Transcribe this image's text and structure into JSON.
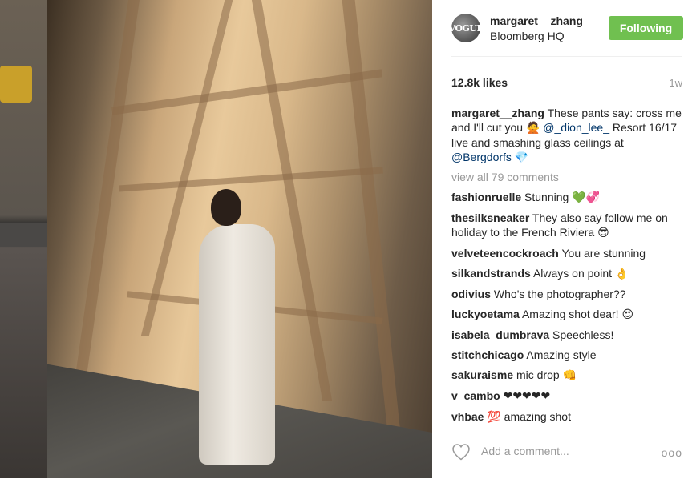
{
  "post": {
    "username": "margaret__zhang",
    "location": "Bloomberg HQ",
    "follow_label": "Following",
    "avatar_text": "VOGUE",
    "likes": "12.8k likes",
    "time": "1w",
    "caption": {
      "user": "margaret__zhang",
      "text_1": " These pants say: cross me and I'll cut you ",
      "emoji_1": "🙅",
      "mention_1": "@_dion_lee_",
      "text_2": " Resort 16/17 live and smashing glass ceilings at ",
      "mention_2": "@Bergdorfs",
      "emoji_2": "💎"
    },
    "view_all": "view all 79 comments",
    "comments": [
      {
        "user": "fashionruelle",
        "text": " Stunning ",
        "emoji": "💚💞"
      },
      {
        "user": "thesilksneaker",
        "text": " They also say follow me on holiday to the French Riviera ",
        "emoji": "😎"
      },
      {
        "user": "velveteencockroach",
        "text": " You are stunning",
        "emoji": ""
      },
      {
        "user": "silkandstrands",
        "text": " Always on point ",
        "emoji": "👌"
      },
      {
        "user": "odivius",
        "text": " Who's the photographer??",
        "emoji": ""
      },
      {
        "user": "luckyoetama",
        "text": " Amazing shot dear! ",
        "emoji": "😍"
      },
      {
        "user": "isabela_dumbrava",
        "text": " Speechless!",
        "emoji": ""
      },
      {
        "user": "stitchchicago",
        "text": " Amazing style",
        "emoji": ""
      },
      {
        "user": "sakuraisme",
        "text": " mic drop ",
        "emoji": "👊"
      },
      {
        "user": "v_cambo",
        "text": " ",
        "emoji": "❤❤❤❤❤"
      },
      {
        "user": "vhbae",
        "text": "  amazing shot",
        "emoji": "💯"
      }
    ],
    "add_comment_placeholder": "Add a comment...",
    "more_label": "ooo"
  },
  "colors": {
    "follow_button": "#70c050",
    "link": "#003569",
    "muted": "#999999"
  }
}
